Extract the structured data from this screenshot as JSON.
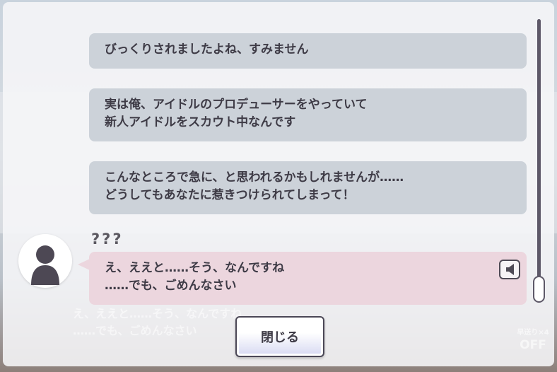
{
  "backlog": {
    "messages": [
      {
        "lines": [
          "びっくりされましたよね、すみません"
        ]
      },
      {
        "lines": [
          "実は俺、アイドルのプロデューサーをやっていて",
          "新人アイドルをスカウト中なんです"
        ]
      },
      {
        "lines": [
          "こんなところで急に、と思われるかもしれませんが……",
          "どうしてもあなたに惹きつけられてしまって！"
        ]
      }
    ],
    "current": {
      "speaker": "???",
      "lines": [
        "え、ええと……そう、なんですね",
        "……でも、ごめんなさい"
      ]
    },
    "close_label": "閉じる"
  },
  "background_text": {
    "lines": [
      "え、ええと……そう、なんですね",
      "……でも、ごめんなさい"
    ]
  },
  "auto_badge": {
    "speed": "早送り×4",
    "state": "OFF"
  },
  "colors": {
    "player_bubble": "#ccd2d9",
    "npc_bubble": "#ecd6de",
    "text": "#3e3b46"
  },
  "icons": {
    "avatar": "silhouette-icon",
    "voice": "speaker-icon"
  }
}
